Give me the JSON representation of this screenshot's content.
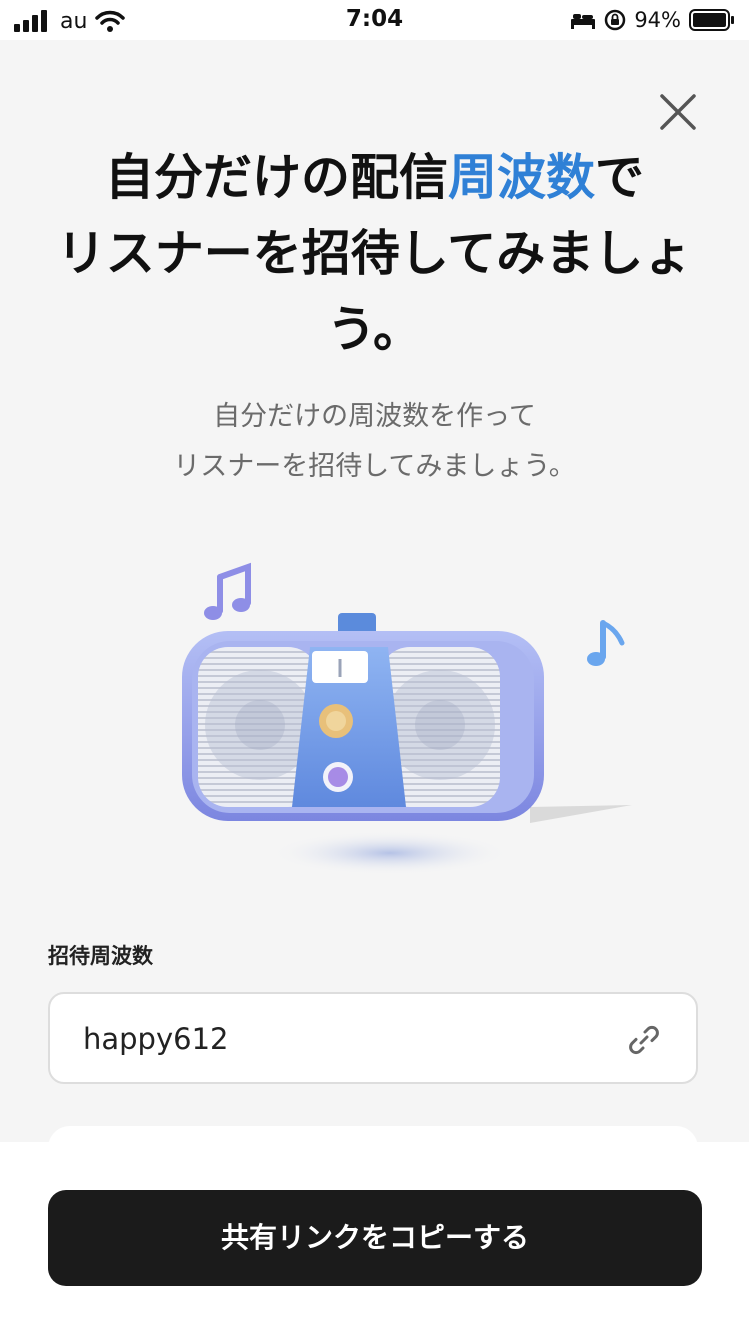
{
  "status_bar": {
    "carrier": "au",
    "time": "7:04",
    "battery_percent": "94%"
  },
  "headline": {
    "part1": "自分だけの配信",
    "highlight": "周波数",
    "part2": "で",
    "line2": "リスナーを招待してみましょ",
    "line3": "う。"
  },
  "subtitle": {
    "line1": "自分だけの周波数を作って",
    "line2": "リスナーを招待してみましょう。"
  },
  "form": {
    "label": "招待周波数",
    "value": "happy612"
  },
  "cta": {
    "label": "共有リンクをコピーする"
  },
  "icons": {
    "close": "close-icon",
    "link": "link-icon",
    "illustration": "radio-speaker-illustration"
  },
  "colors": {
    "accent": "#2f80d6",
    "button_bg": "#1b1b1b"
  }
}
